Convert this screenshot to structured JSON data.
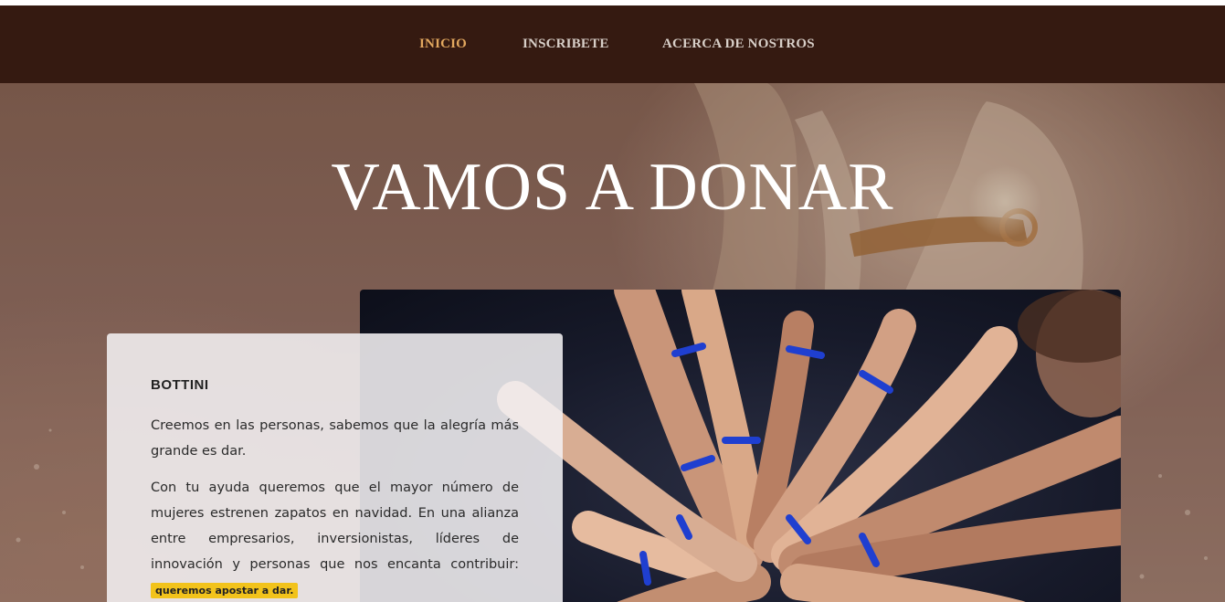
{
  "nav": {
    "items": [
      {
        "label": "INICIO",
        "active": true
      },
      {
        "label": "INSCRIBETE",
        "active": false
      },
      {
        "label": "ACERCA DE NOSTROS",
        "active": false
      }
    ],
    "active_color": "#e2a85f",
    "background_color": "#351a11"
  },
  "hero": {
    "title": "VAMOS A DONAR"
  },
  "card": {
    "title": "BOTTINI",
    "paragraph1": "Creemos en las personas, sabemos que la alegría más grande es dar.",
    "paragraph2": "Con tu ayuda queremos que el mayor número de mujeres estrenen zapatos en navidad. En una alianza entre empresarios, inversionistas, líderes de innovación y personas que nos encanta contribuir:",
    "highlight": "queremos apostar a dar.",
    "highlight_color": "#f2c31b"
  },
  "photo": {
    "icon": "hands-together-photo",
    "wristband_color": "#1f3fd0"
  }
}
